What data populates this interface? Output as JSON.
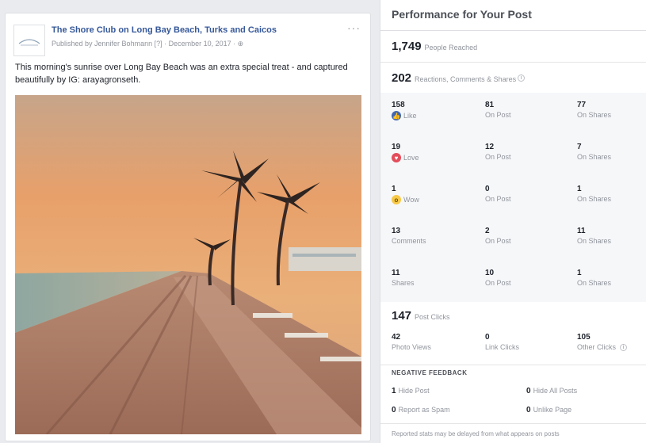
{
  "post": {
    "page_name": "The Shore Club on Long Bay Beach, Turks and Caicos",
    "meta": "Published by Jennifer Bohmann [?] · December 10, 2017 · ",
    "text": "This morning's sunrise over Long Bay Beach was an extra special treat - and captured beautifully by IG: arayagronseth.",
    "more_label": "···"
  },
  "insights": {
    "title": "Performance for Your Post",
    "people_reached": {
      "value": "1,749",
      "label": "People Reached"
    },
    "reactions": {
      "value": "202",
      "label": "Reactions, Comments & Shares"
    },
    "breakdown": [
      {
        "total": "158",
        "label": "Like",
        "icon": "like-icon",
        "on_post": "81",
        "on_post_label": "On Post",
        "on_shares": "77",
        "on_shares_label": "On Shares"
      },
      {
        "total": "19",
        "label": "Love",
        "icon": "love-icon",
        "on_post": "12",
        "on_post_label": "On Post",
        "on_shares": "7",
        "on_shares_label": "On Shares"
      },
      {
        "total": "1",
        "label": "Wow",
        "icon": "wow-icon",
        "on_post": "0",
        "on_post_label": "On Post",
        "on_shares": "1",
        "on_shares_label": "On Shares"
      },
      {
        "total": "13",
        "label": "Comments",
        "on_post": "2",
        "on_post_label": "On Post",
        "on_shares": "11",
        "on_shares_label": "On Shares"
      },
      {
        "total": "11",
        "label": "Shares",
        "on_post": "10",
        "on_post_label": "On Post",
        "on_shares": "1",
        "on_shares_label": "On Shares"
      }
    ],
    "post_clicks": {
      "value": "147",
      "label": "Post Clicks"
    },
    "clicks": [
      {
        "value": "42",
        "label": "Photo Views"
      },
      {
        "value": "0",
        "label": "Link Clicks"
      },
      {
        "value": "105",
        "label": "Other Clicks"
      }
    ],
    "negative_feedback": {
      "title": "NEGATIVE FEEDBACK",
      "items": [
        {
          "value": "1",
          "label": "Hide Post"
        },
        {
          "value": "0",
          "label": "Hide All Posts"
        },
        {
          "value": "0",
          "label": "Report as Spam"
        },
        {
          "value": "0",
          "label": "Unlike Page"
        }
      ]
    },
    "footnote": "Reported stats may be delayed from what appears on posts"
  },
  "colors": {
    "link": "#365899",
    "like": "#4267b2",
    "love": "#e34d5c",
    "wow": "#f7c948"
  }
}
